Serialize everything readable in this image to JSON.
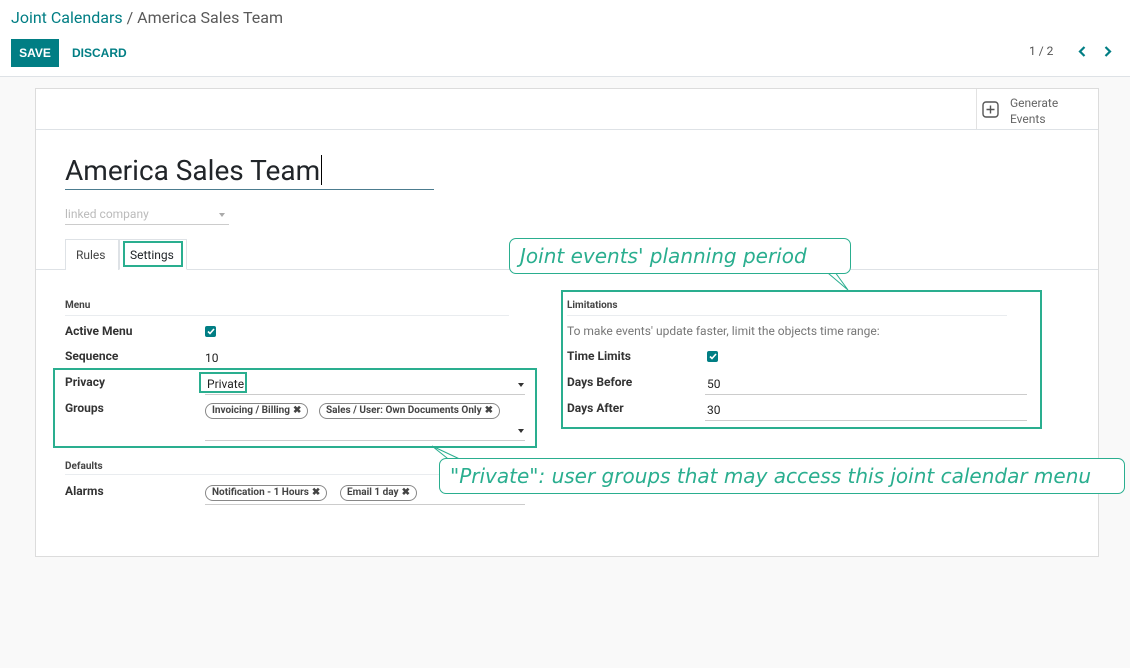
{
  "breadcrumb": {
    "parent": "Joint Calendars",
    "separator": " / ",
    "current": "America Sales Team"
  },
  "toolbar": {
    "save_label": "SAVE",
    "discard_label": "DISCARD"
  },
  "pager": {
    "value": "1 / 2"
  },
  "button_box": {
    "generate_label_1": "Generate",
    "generate_label_2": "Events"
  },
  "form": {
    "name": "America Sales Team",
    "company_placeholder": "linked company"
  },
  "tabs": [
    {
      "label": "Rules"
    },
    {
      "label": "Settings"
    }
  ],
  "menu_group": {
    "title": "Menu",
    "active_menu_label": "Active Menu",
    "sequence_label": "Sequence",
    "sequence_value": "10",
    "privacy_label": "Privacy",
    "privacy_value": "Private",
    "groups_label": "Groups",
    "groups": [
      "Invoicing / Billing",
      "Sales / User: Own Documents Only"
    ]
  },
  "defaults_group": {
    "title": "Defaults",
    "alarms_label": "Alarms",
    "alarms": [
      "Notification - 1 Hours",
      "Email 1 day"
    ]
  },
  "limitations_group": {
    "title": "Limitations",
    "help": "To make events' update faster, limit the objects time range:",
    "time_limits_label": "Time Limits",
    "days_before_label": "Days Before",
    "days_before_value": "50",
    "days_after_label": "Days After",
    "days_after_value": "30"
  },
  "annotations": {
    "callout_top": "Joint events' planning period",
    "callout_bottom": "\"Private\": user groups that may access this joint calendar menu"
  },
  "colors": {
    "accent": "#017e84",
    "highlight": "#2aae8f"
  }
}
